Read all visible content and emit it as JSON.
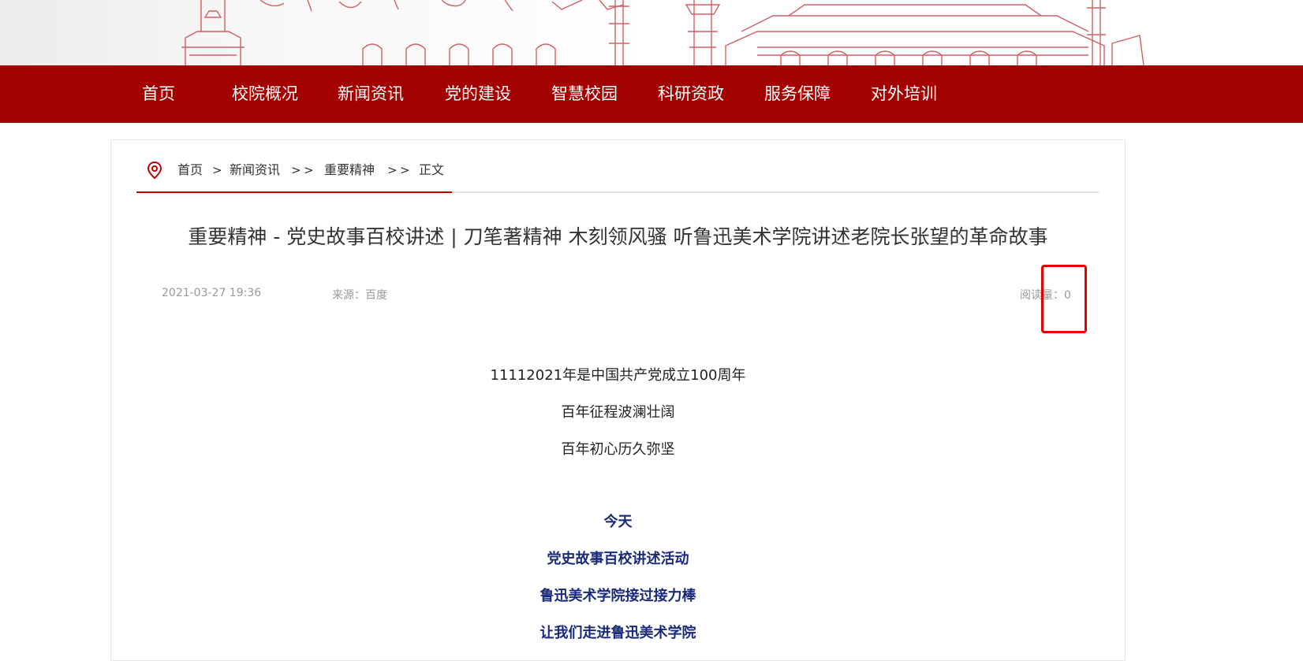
{
  "nav": {
    "items": [
      "首页",
      "校院概况",
      "新闻资讯",
      "党的建设",
      "智慧校园",
      "科研资政",
      "服务保障",
      "对外培训"
    ]
  },
  "breadcrumb": {
    "items": [
      "首页",
      "新闻资讯",
      "重要精神",
      "正文"
    ],
    "separator": ">"
  },
  "article": {
    "title": "重要精神 - 党史故事百校讲述 | 刀笔著精神 木刻领风骚 听鲁迅美术学院讲述老院长张望的革命故事",
    "date": "2021-03-27 19:36",
    "source": "来源：百度",
    "read_count": "阅读量：0",
    "paragraphs": [
      "11112021年是中国共产党成立100周年",
      "百年征程波澜壮阔",
      "百年初心历久弥坚"
    ],
    "bold_paragraphs": [
      "今天",
      "党史故事百校讲述活动",
      "鲁迅美术学院接过接力棒",
      "让我们走进鲁迅美术学院"
    ]
  },
  "colors": {
    "nav_bg": "#a30000",
    "accent_red": "#c00000",
    "highlight_box": "#e30000",
    "bold_text": "#1a2a7a"
  },
  "icons": {
    "location": "location-pin-icon"
  }
}
